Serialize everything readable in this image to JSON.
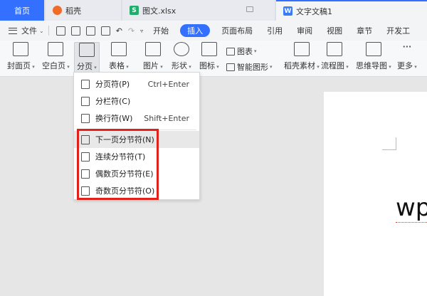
{
  "tabs": {
    "home": "首页",
    "daoke": "稻壳",
    "xlsx": "图文.xlsx",
    "doc": "文字文稿1"
  },
  "menubar": {
    "file": "文件",
    "tabs": [
      "开始",
      "插入",
      "页面布局",
      "引用",
      "审阅",
      "视图",
      "章节",
      "开发工"
    ],
    "active": "插入"
  },
  "ribbon": {
    "cover": "封面页",
    "blank": "空白页",
    "page_break": "分页",
    "table": "表格",
    "picture": "图片",
    "shape": "形状",
    "icon": "图标",
    "chart": "图表",
    "smart_graphic": "智能图形",
    "daoke_material": "稻壳素材",
    "flowchart": "流程图",
    "mindmap": "思维导图",
    "more": "更多"
  },
  "dropdown": {
    "items": [
      {
        "label": "分页符(P)",
        "shortcut": "Ctrl+Enter"
      },
      {
        "label": "分栏符(C)",
        "shortcut": ""
      },
      {
        "label": "换行符(W)",
        "shortcut": "Shift+Enter"
      },
      {
        "label": "下一页分节符(N)",
        "shortcut": ""
      },
      {
        "label": "连续分节符(T)",
        "shortcut": ""
      },
      {
        "label": "偶数页分节符(E)",
        "shortcut": ""
      },
      {
        "label": "奇数页分节符(O)",
        "shortcut": ""
      }
    ],
    "highlight_color": "#e0221a"
  },
  "document": {
    "text": "wp"
  },
  "colors": {
    "accent": "#3370ff"
  }
}
